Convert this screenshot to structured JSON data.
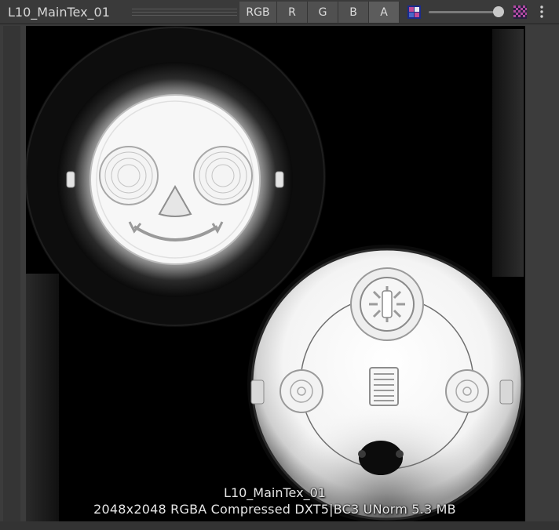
{
  "toolbar": {
    "title": "L10_MainTex_01",
    "channels": [
      {
        "label": "RGB",
        "active": false
      },
      {
        "label": "R",
        "active": false
      },
      {
        "label": "G",
        "active": false
      },
      {
        "label": "B",
        "active": false
      },
      {
        "label": "A",
        "active": true
      }
    ],
    "mip_slider_value": 1.0,
    "icons": [
      "low-mip-checker-icon",
      "high-mip-checker-icon",
      "more-menu-icon"
    ]
  },
  "preview": {
    "name": "L10_MainTex_01",
    "details": "2048x2048  RGBA Compressed DXT5|BC3 UNorm   5.3 MB"
  },
  "colors": {
    "toolbar_bg": "#3a3a3a",
    "button_bg": "#505050",
    "active_button_bg": "#5c5c5c",
    "viewport_bg": "#3c3c3c"
  }
}
